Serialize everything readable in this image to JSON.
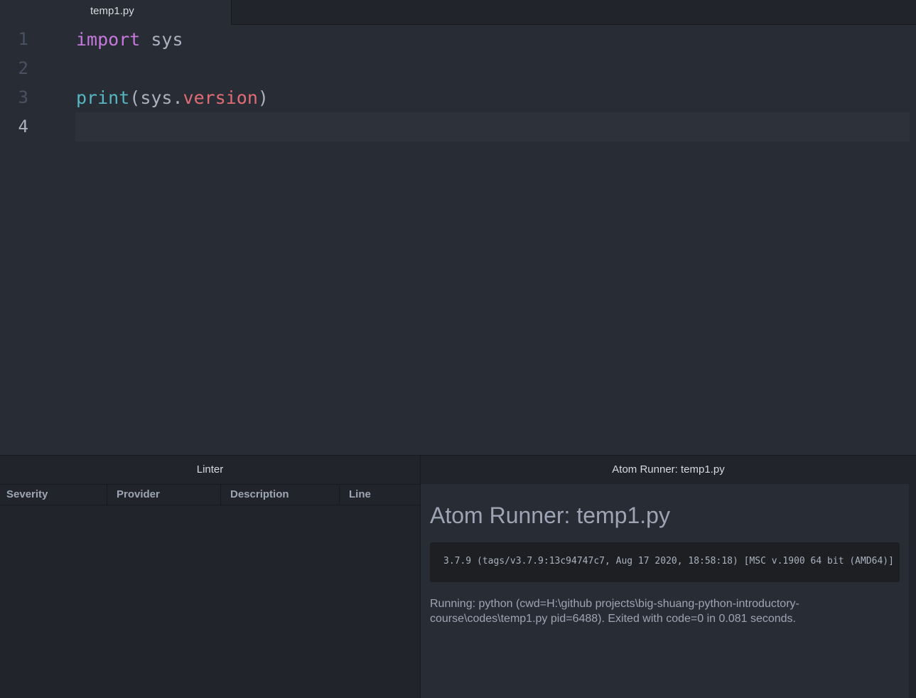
{
  "tabs": [
    {
      "label": "temp1.py",
      "active": true
    }
  ],
  "editor": {
    "lines": [
      {
        "number": "1",
        "tokens": [
          {
            "text": "import",
            "type": "keyword"
          },
          {
            "text": " sys",
            "type": "plain"
          }
        ]
      },
      {
        "number": "2",
        "tokens": []
      },
      {
        "number": "3",
        "tokens": [
          {
            "text": "print",
            "type": "func"
          },
          {
            "text": "(sys.",
            "type": "plain"
          },
          {
            "text": "version",
            "type": "prop"
          },
          {
            "text": ")",
            "type": "plain"
          }
        ]
      },
      {
        "number": "4",
        "tokens": [],
        "cursor": true
      }
    ]
  },
  "linter": {
    "title": "Linter",
    "columns": [
      "Severity",
      "Provider",
      "Description",
      "Line"
    ]
  },
  "runner": {
    "title": "Atom Runner: temp1.py",
    "heading": "Atom Runner: temp1.py",
    "output": "3.7.9 (tags/v3.7.9:13c94747c7, Aug 17 2020, 18:58:18) [MSC v.1900 64 bit (AMD64)]",
    "status": "Running: python (cwd=H:\\github projects\\big-shuang-python-introductory-course\\codes\\temp1.py pid=6488). Exited with code=0 in 0.081 seconds."
  },
  "colors": {
    "keyword": "#c678dd",
    "function": "#56b6c2",
    "property": "#e06c75",
    "background": "#282c34"
  }
}
